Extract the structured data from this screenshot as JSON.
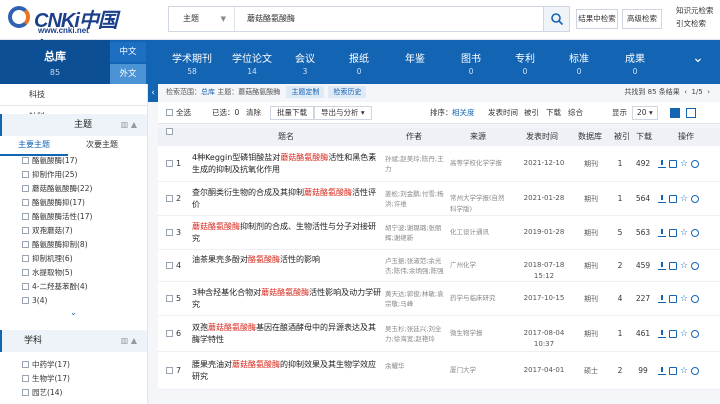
{
  "brand": {
    "name": "CNKi中国知网",
    "url": "www.cnki.net"
  },
  "search": {
    "field": "主题",
    "query": "蘑菇酪氨酸酶"
  },
  "header_buttons": {
    "within": "结果中检索",
    "advanced": "高级检索"
  },
  "top_links": [
    "知识元检索",
    "引文检索"
  ],
  "nav": {
    "total": {
      "label": "总库",
      "count": "85"
    },
    "lang": [
      "中文",
      "外文"
    ],
    "tabs": [
      {
        "label": "学术期刊",
        "count": "58"
      },
      {
        "label": "学位论文",
        "count": "14"
      },
      {
        "label": "会议",
        "count": "3"
      },
      {
        "label": "报纸",
        "count": "0"
      },
      {
        "label": "年鉴",
        "count": ""
      },
      {
        "label": "图书",
        "count": "0"
      },
      {
        "label": "专利",
        "count": "0"
      },
      {
        "label": "标准",
        "count": "0"
      },
      {
        "label": "成果",
        "count": "0"
      }
    ]
  },
  "sidebar": {
    "cat_tabs": [
      "科技",
      "社科"
    ],
    "topic_header": "主题",
    "subtabs": [
      "主要主题",
      "次要主题"
    ],
    "topics": [
      "酪氨酸酶(17)",
      "抑制作用(25)",
      "蘑菇酪氨酸酶(22)",
      "酪氨酸酶抑(17)",
      "酪氨酸酶活性(17)",
      "双孢蘑菇(7)",
      "酪氨酸酶抑制(8)",
      "抑制机理(6)",
      "水提取物(5)",
      "4-二羟基苯酚(4)",
      "3(4)"
    ],
    "subject_header": "学科",
    "subjects": [
      "中药学(17)",
      "生物学(17)",
      "园艺(14)"
    ]
  },
  "crumb": {
    "prefix": "检索范围：",
    "scope": "总库",
    "topic_label": "主题：",
    "topic": "蘑菇酪氨酸酶",
    "btn_topic": "主题定制",
    "btn_history": "检索历史",
    "summary": "共找到 85 条结果",
    "page": "1/5"
  },
  "toolbar": {
    "select_all": "全选",
    "selected": "已选：",
    "selected_count": "0",
    "clear": "清除",
    "batch": "批量下载",
    "export": "导出与分析",
    "sort_label": "排序：",
    "sort_opts": [
      "相关度",
      "发表时间",
      "被引",
      "下载",
      "综合"
    ],
    "show_label": "显示",
    "show_val": "20"
  },
  "table": {
    "headers": [
      "题名",
      "作者",
      "来源",
      "发表时间",
      "数据库",
      "被引",
      "下载",
      "操作"
    ],
    "rows": [
      {
        "idx": "1",
        "pre": "4种Keggin型磷钼酸盐对",
        "hl": "蘑菇酪氨酸酶",
        "post": "活性和黑色素生成的抑制及抗氧化作用",
        "author": "孙斌;赵美玲;陈丹;王力",
        "source": "高等学校化学学报",
        "date": "2021-12-10",
        "db": "期刊",
        "cite": "1",
        "dl": "492"
      },
      {
        "idx": "2",
        "pre": "查尔酮类衍生物的合成及其抑制",
        "hl": "蘑菇酪氨酸酶",
        "post": "活性评价",
        "author": "姜松;刘金鹏;付雪;杨洪;许维",
        "source": "常州大学学报(自然科学版)",
        "date": "2021-01-28",
        "db": "期刊",
        "cite": "1",
        "dl": "564"
      },
      {
        "idx": "3",
        "pre": "",
        "hl": "蘑菇酪氨酸酶",
        "post": "抑制剂的合成、生物活性与分子对接研究",
        "author": "胡宁波;谢璐璐;张丽辉;谢继新",
        "source": "化工设计通讯",
        "date": "2019-01-28",
        "db": "期刊",
        "cite": "5",
        "dl": "563"
      },
      {
        "idx": "4",
        "pre": "油茶果壳多酚对",
        "hl": "酪氨酸酶",
        "post": "活性的影响",
        "author": "卢玉振;张淑范;余光杰;陈伟;余炳强;陈强",
        "source": "广州化学",
        "date": "2018-07-18 15:12",
        "db": "期刊",
        "cite": "2",
        "dl": "459"
      },
      {
        "idx": "5",
        "pre": "3种含羟基化合物对",
        "hl": "蘑菇酪氨酸酶",
        "post": "活性影响及动力学研究",
        "author": "黄天达;郭俊;林敏;袁宗敬;马峰",
        "source": "药学与临床研究",
        "date": "2017-10-15",
        "db": "期刊",
        "cite": "4",
        "dl": "227"
      },
      {
        "idx": "6",
        "pre": "双孢",
        "hl": "蘑菇酪氨酸酶",
        "post": "基因在酿酒酵母中的异源表达及其酶学特性",
        "author": "吴玉杉;张廷兴;刘全力;徐海宽;赵艳玲",
        "source": "微生物学报",
        "date": "2017-08-04 10:37",
        "db": "期刊",
        "cite": "1",
        "dl": "461"
      },
      {
        "idx": "7",
        "pre": "腰果壳油对",
        "hl": "蘑菇酪氨酸酶",
        "post": "的抑制效果及其生物学效应研究",
        "author": "余耀华",
        "source": "厦门大学",
        "date": "2017-04-01",
        "db": "硕士",
        "cite": "2",
        "dl": "99"
      }
    ]
  }
}
